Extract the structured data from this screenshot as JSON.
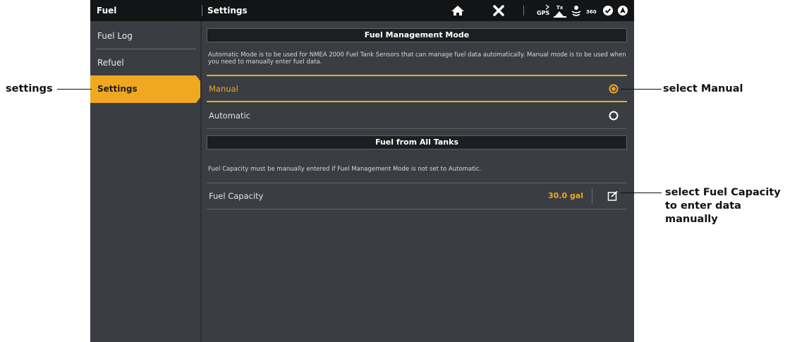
{
  "topbar": {
    "left_title": "Fuel",
    "right_title": "Settings",
    "icons": [
      "home-icon",
      "close-icon",
      "gps-icon",
      "transducer-icon",
      "sonar-icon",
      "360-icon",
      "check-status-icon",
      "navigation-icon"
    ],
    "gps_label": "GPS",
    "tx_label": "Tx",
    "label_360": "360"
  },
  "sidebar": {
    "items": [
      {
        "label": "Fuel Log"
      },
      {
        "label": "Refuel"
      },
      {
        "label": "Settings",
        "active": true
      }
    ]
  },
  "main": {
    "section1": {
      "title": "Fuel Management Mode",
      "description": "Automatic Mode is to be used for NMEA 2000 Fuel Tank Sensors that can manage fuel data automatically. Manual mode is to be used when you need to manually enter fuel data.",
      "options": [
        {
          "label": "Manual",
          "selected": true
        },
        {
          "label": "Automatic",
          "selected": false
        }
      ]
    },
    "section2": {
      "title": "Fuel from All Tanks",
      "description": "Fuel Capacity must be manually entered if Fuel Management Mode is not set to Automatic.",
      "row": {
        "label": "Fuel Capacity",
        "value": "30.0 gal"
      }
    }
  },
  "callouts": {
    "settings": "settings",
    "select_manual": "select Manual",
    "fuel_capacity": [
      "select Fuel Capacity",
      "to enter data",
      "manually"
    ]
  },
  "colors": {
    "accent": "#f0a820",
    "screen_bg": "#3a3d42",
    "topbar_bg": "#121416",
    "header_bg": "#1c1e21"
  }
}
